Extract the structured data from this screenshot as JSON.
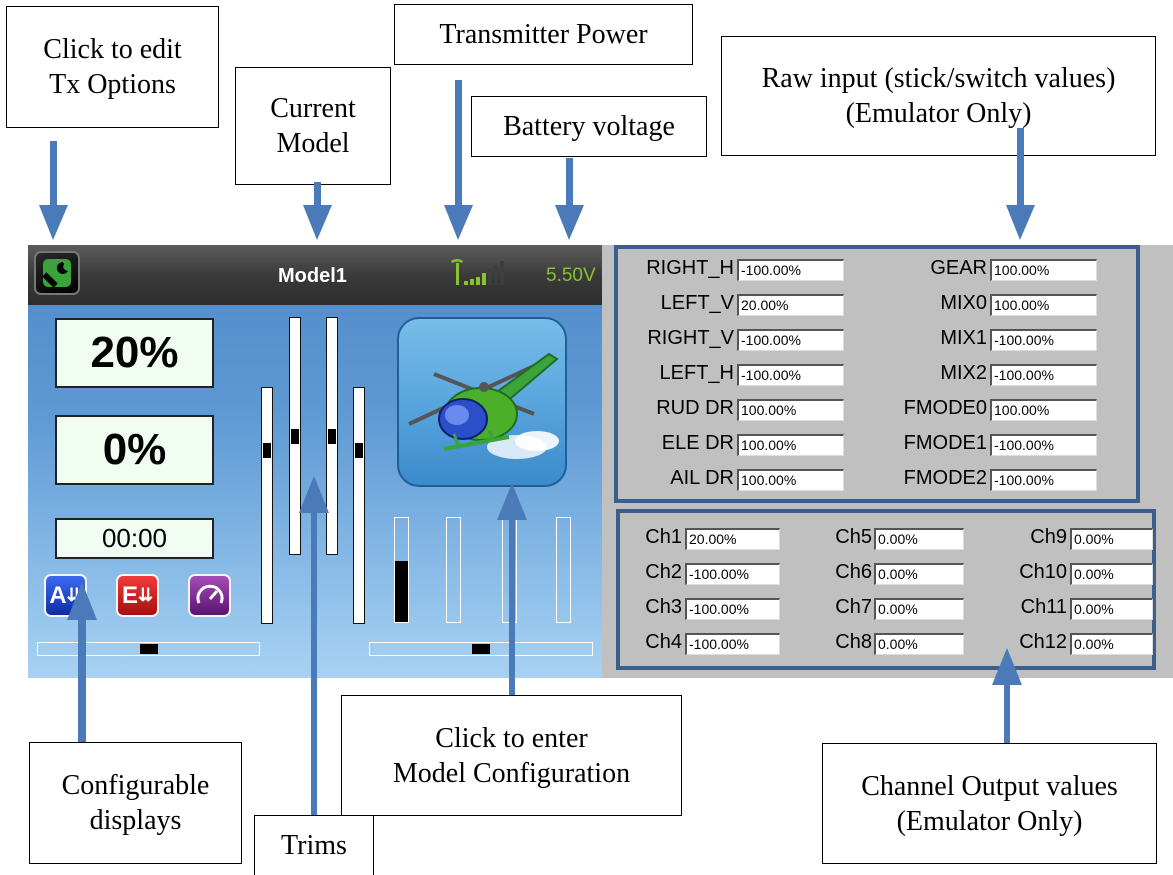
{
  "callouts": {
    "tx_options": [
      "Click to edit",
      "Tx Options"
    ],
    "current_model": [
      "Current",
      "Model"
    ],
    "tx_power": [
      "Transmitter Power"
    ],
    "battery": [
      "Battery voltage"
    ],
    "raw_input": [
      "Raw input (stick/switch values)",
      "(Emulator Only)"
    ],
    "configurable": [
      "Configurable",
      "displays"
    ],
    "trims": [
      "Trims"
    ],
    "model_config": [
      "Click to enter",
      "Model Configuration"
    ],
    "channel_output": [
      "Channel Output values",
      "(Emulator Only)"
    ]
  },
  "tx": {
    "model_name": "Model1",
    "voltage": "5.50V",
    "display1": "20%",
    "display2": "0%",
    "timer": "00:00",
    "icons": [
      "A",
      "E"
    ],
    "icon_names": [
      "aileron-icon",
      "elevator-icon",
      "gauge-icon"
    ],
    "colors": {
      "voltage": "#88c232",
      "icon_a": "#1a3fc0",
      "icon_e": "#d01c1c",
      "icon_gauge": "#7a2a8a"
    },
    "trim_levels": {
      "h_left": 0.5,
      "v1": 0.25,
      "v2": 0.5,
      "v3": 0.5,
      "v4": 0.25,
      "h_right": 0.5
    },
    "bar_levels": [
      0.6,
      0,
      0,
      0
    ]
  },
  "raw_inputs": {
    "left": [
      {
        "label": "RIGHT_H",
        "value": "-100.00%"
      },
      {
        "label": "LEFT_V",
        "value": "20.00%"
      },
      {
        "label": "RIGHT_V",
        "value": "-100.00%"
      },
      {
        "label": "LEFT_H",
        "value": "-100.00%"
      },
      {
        "label": "RUD DR",
        "value": "100.00%"
      },
      {
        "label": "ELE DR",
        "value": "100.00%"
      },
      {
        "label": "AIL DR",
        "value": "100.00%"
      }
    ],
    "right": [
      {
        "label": "GEAR",
        "value": "100.00%"
      },
      {
        "label": "MIX0",
        "value": "100.00%"
      },
      {
        "label": "MIX1",
        "value": "-100.00%"
      },
      {
        "label": "MIX2",
        "value": "-100.00%"
      },
      {
        "label": "FMODE0",
        "value": "100.00%"
      },
      {
        "label": "FMODE1",
        "value": "-100.00%"
      },
      {
        "label": "FMODE2",
        "value": "-100.00%"
      }
    ]
  },
  "channels": {
    "col1": [
      {
        "label": "Ch1",
        "value": "20.00%"
      },
      {
        "label": "Ch2",
        "value": "-100.00%"
      },
      {
        "label": "Ch3",
        "value": "-100.00%"
      },
      {
        "label": "Ch4",
        "value": "-100.00%"
      }
    ],
    "col2": [
      {
        "label": "Ch5",
        "value": "0.00%"
      },
      {
        "label": "Ch6",
        "value": "0.00%"
      },
      {
        "label": "Ch7",
        "value": "0.00%"
      },
      {
        "label": "Ch8",
        "value": "0.00%"
      }
    ],
    "col3": [
      {
        "label": "Ch9",
        "value": "0.00%"
      },
      {
        "label": "Ch10",
        "value": "0.00%"
      },
      {
        "label": "Ch11",
        "value": "0.00%"
      },
      {
        "label": "Ch12",
        "value": "0.00%"
      }
    ]
  }
}
